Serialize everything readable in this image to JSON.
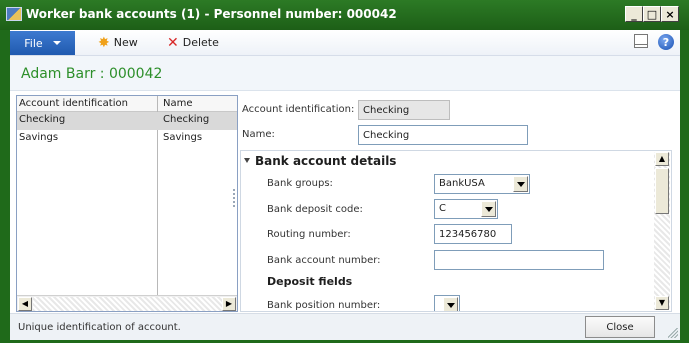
{
  "window": {
    "title": "Worker bank accounts (1) - Personnel number: 000042",
    "icon": "app-form-icon",
    "controls": [
      "minimize",
      "maximize",
      "close"
    ]
  },
  "toolbar": {
    "file_label": "File",
    "new_label": "New",
    "delete_label": "Delete",
    "icons": [
      "new-star-icon",
      "delete-x-icon",
      "panel-icon",
      "help-icon"
    ]
  },
  "record_title": "Adam Barr : 000042",
  "grid": {
    "columns": [
      "Account identification",
      "Name"
    ],
    "rows": [
      {
        "id": "Checking",
        "name": "Checking",
        "selected": true
      },
      {
        "id": "Savings",
        "name": "Savings",
        "selected": false
      }
    ]
  },
  "form": {
    "account_id_label": "Account identification:",
    "account_id_value": "Checking",
    "name_label": "Name:",
    "name_value": "Checking"
  },
  "details": {
    "section_title": "Bank account details",
    "bank_groups_label": "Bank groups:",
    "bank_groups_value": "BankUSA",
    "deposit_code_label": "Bank deposit code:",
    "deposit_code_value": "C",
    "routing_label": "Routing number:",
    "routing_value": "123456780",
    "account_number_label": "Bank account number:",
    "account_number_value": "",
    "deposit_fields_title": "Deposit fields",
    "position_label": "Bank position number:",
    "position_value": ""
  },
  "status": {
    "text": "Unique identification of account.",
    "close_label": "Close"
  },
  "colors": {
    "window_frame": "#1f6a1a",
    "title_green": "#2d8f2a",
    "file_button": "#2b66bf",
    "selected_row": "#d9d9d9"
  }
}
